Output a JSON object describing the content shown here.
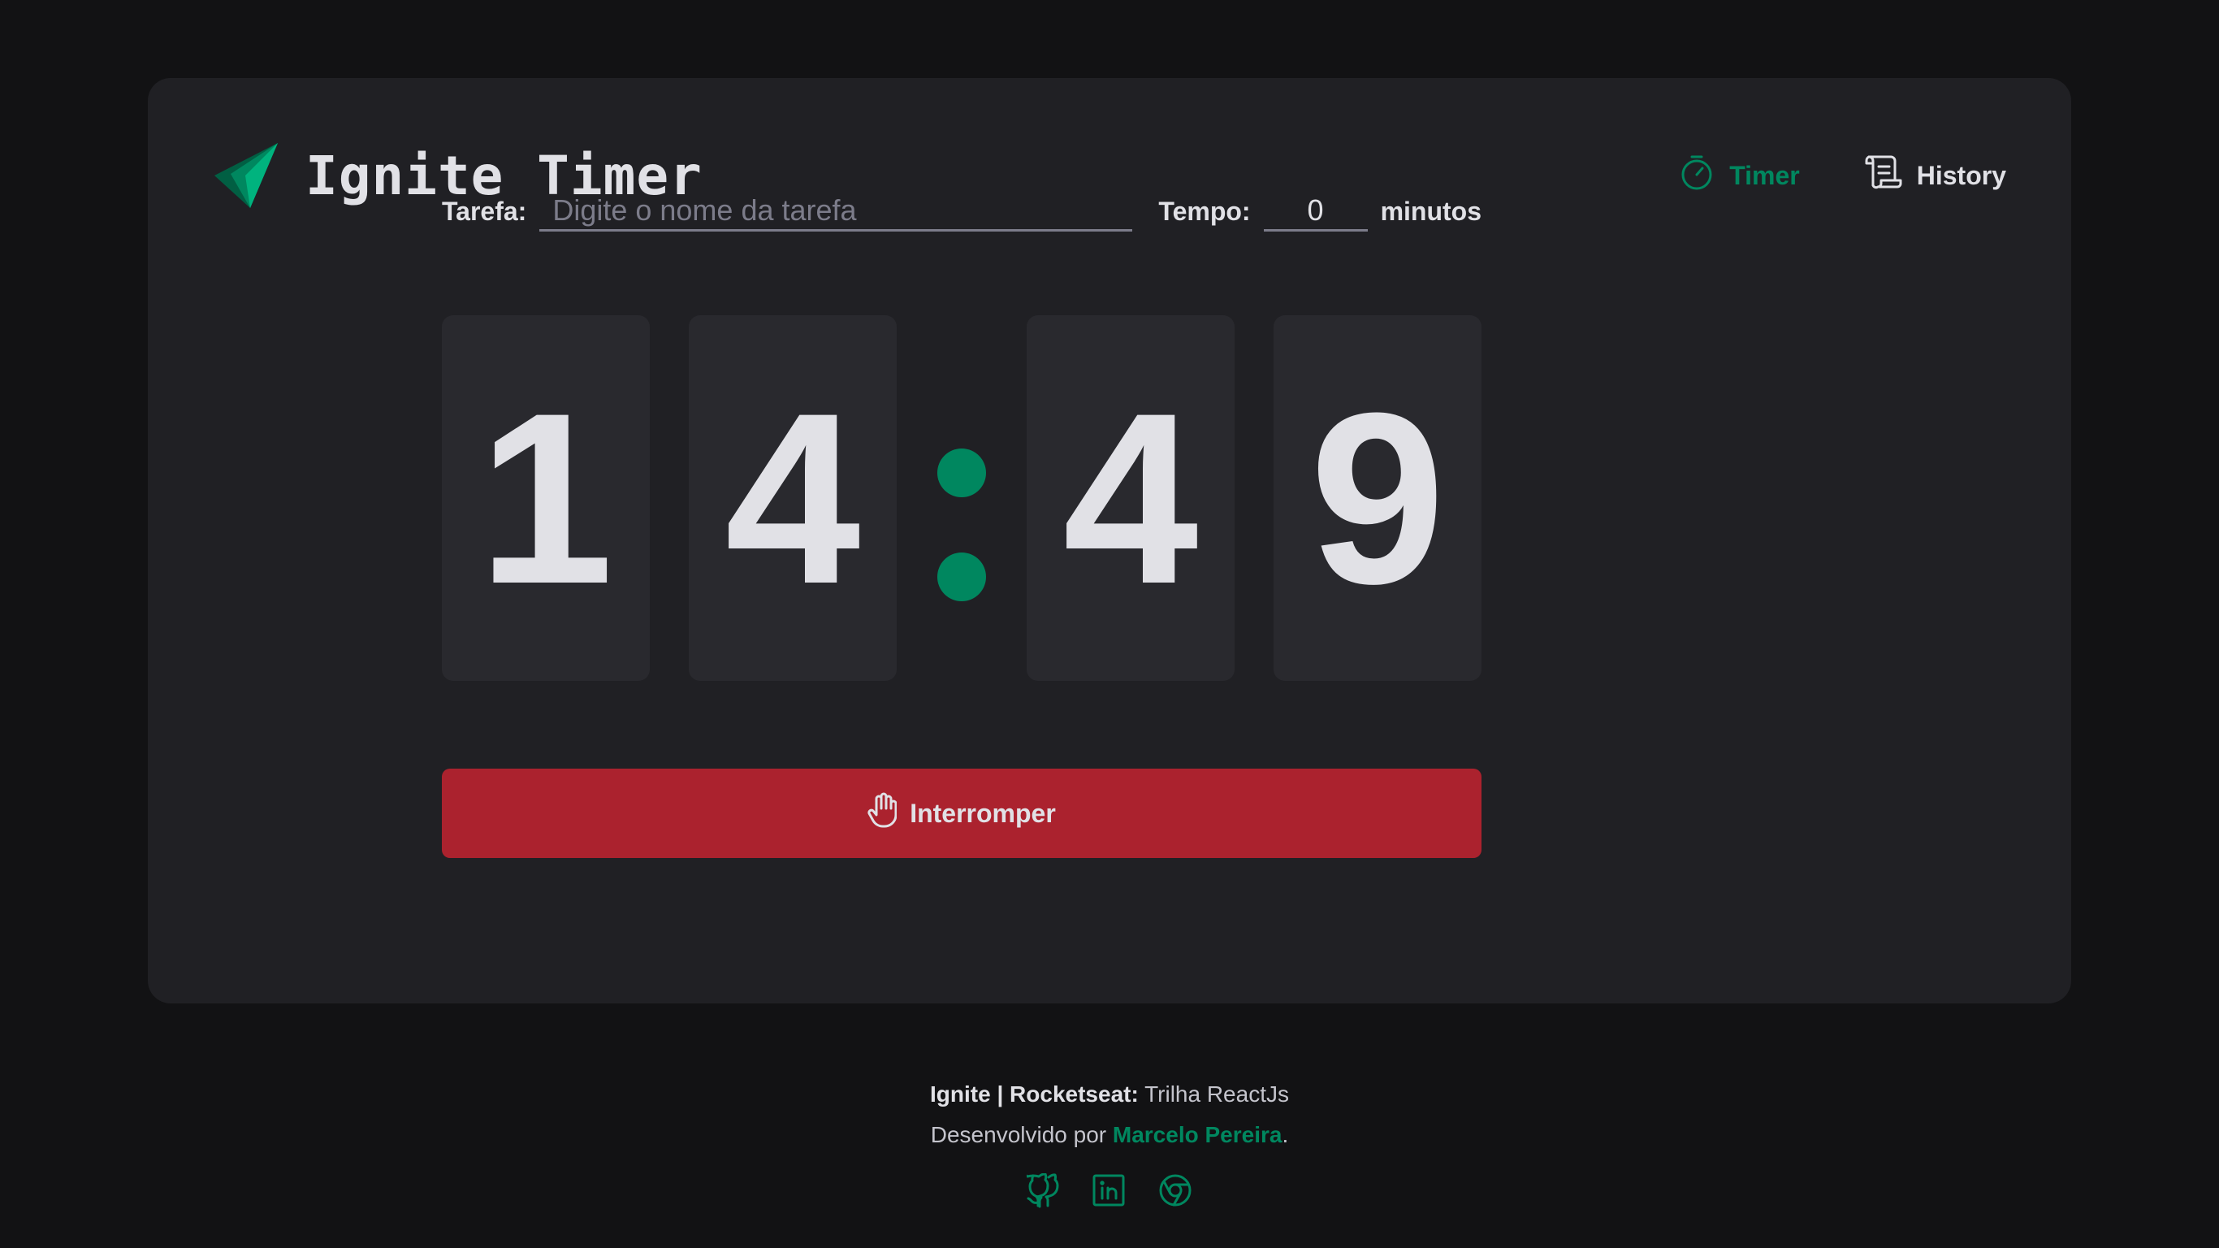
{
  "app": {
    "title": "Ignite Timer"
  },
  "nav": {
    "items": [
      {
        "label": "Timer",
        "icon": "timer-icon",
        "active": true
      },
      {
        "label": "History",
        "icon": "scroll-icon",
        "active": false
      }
    ]
  },
  "form": {
    "task_label": "Tarefa:",
    "task_placeholder": "Digite o nome da tarefa",
    "task_value": "",
    "time_label": "Tempo:",
    "time_value": "0",
    "minutes_label": "minutos"
  },
  "countdown": {
    "minutes_tens": "1",
    "minutes_ones": "4",
    "seconds_tens": "4",
    "seconds_ones": "9"
  },
  "action": {
    "label": "Interromper",
    "icon": "hand-icon"
  },
  "footer": {
    "brand_bold": "Ignite | Rocketseat:",
    "brand_rest": "Trilha ReactJs",
    "credit_prefix": "Desenvolvido por",
    "credit_author": "Marcelo Pereira",
    "credit_suffix": ".",
    "social": [
      "github-icon",
      "linkedin-icon",
      "chrome-icon"
    ]
  },
  "colors": {
    "background": "#121214",
    "card": "#202024",
    "digit_bg": "#29292e",
    "accent": "#00875f",
    "danger": "#ab222e",
    "text": "#e1e1e6"
  }
}
